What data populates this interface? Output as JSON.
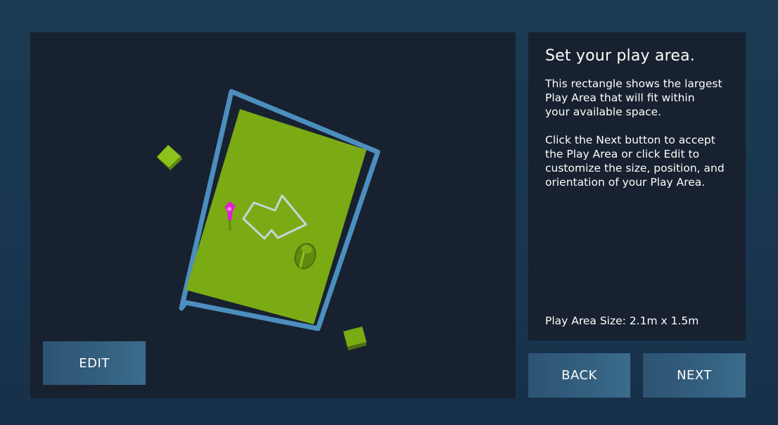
{
  "info": {
    "title": "Set your play area.",
    "paragraph1": "This rectangle shows the largest\nPlay Area that will fit within\nyour available space.",
    "paragraph2": "Click the Next button to accept\nthe Play Area or click Edit to\ncustomize the size, position, and\norientation of your Play Area.",
    "size_label": "Play Area Size: 2.1m x 1.5m"
  },
  "buttons": {
    "edit": "EDIT",
    "back": "BACK",
    "next": "NEXT"
  },
  "colors": {
    "boundary": "#4c8fbf",
    "play_area": "#7aab14",
    "controller": "#7aab14",
    "hmd_marker": "#e020d0",
    "arrow_outline": "#c9d2d8"
  },
  "icons": {
    "direction_arrow": "arrow-right-outline",
    "hmd": "headset-marker",
    "controller": "controller-tracker",
    "base_station": "base-station-cube"
  }
}
